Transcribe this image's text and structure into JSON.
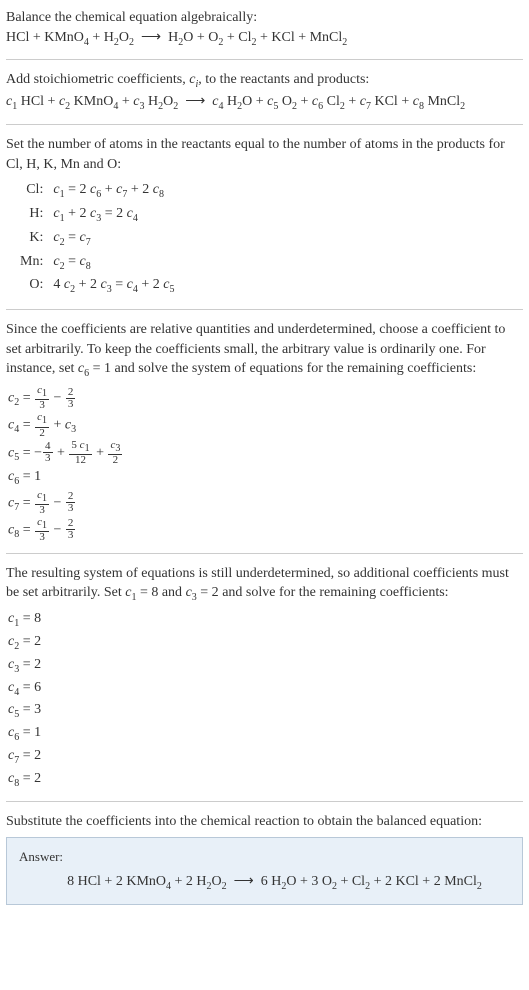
{
  "s1": {
    "line1": "Balance the chemical equation algebraically:",
    "eq": "HCl + KMnO₄ + H₂O₂ ⟶ H₂O + O₂ + Cl₂ + KCl + MnCl₂"
  },
  "s2": {
    "line1_a": "Add stoichiometric coefficients, ",
    "line1_ci": "cᵢ",
    "line1_b": ", to the reactants and products:",
    "eq": "c₁ HCl + c₂ KMnO₄ + c₃ H₂O₂ ⟶ c₄ H₂O + c₅ O₂ + c₆ Cl₂ + c₇ KCl + c₈ MnCl₂"
  },
  "s3": {
    "line1": "Set the number of atoms in the reactants equal to the number of atoms in the products for Cl, H, K, Mn and O:",
    "rows": [
      {
        "el": "Cl:",
        "eq": "c₁ = 2 c₆ + c₇ + 2 c₈"
      },
      {
        "el": "H:",
        "eq": "c₁ + 2 c₃ = 2 c₄"
      },
      {
        "el": "K:",
        "eq": "c₂ = c₇"
      },
      {
        "el": "Mn:",
        "eq": "c₂ = c₈"
      },
      {
        "el": "O:",
        "eq": "4 c₂ + 2 c₃ = c₄ + 2 c₅"
      }
    ]
  },
  "s4": {
    "para": "Since the coefficients are relative quantities and underdetermined, choose a coefficient to set arbitrarily. To keep the coefficients small, the arbitrary value is ordinarily one. For instance, set c₆ = 1 and solve the system of equations for the remaining coefficients:"
  },
  "s5": {
    "para_a": "The resulting system of equations is still underdetermined, so additional coefficients must be set arbitrarily. Set ",
    "para_mid1": "c₁ = 8",
    "para_mid2": " and ",
    "para_mid3": "c₃ = 2",
    "para_b": " and solve for the remaining coefficients:",
    "rows": [
      "c₁ = 8",
      "c₂ = 2",
      "c₃ = 2",
      "c₄ = 6",
      "c₅ = 3",
      "c₆ = 1",
      "c₇ = 2",
      "c₈ = 2"
    ]
  },
  "s6": {
    "para": "Substitute the coefficients into the chemical reaction to obtain the balanced equation:"
  },
  "answer": {
    "label": "Answer:",
    "eq": "8 HCl + 2 KMnO₄ + 2 H₂O₂ ⟶ 6 H₂O + 3 O₂ + Cl₂ + 2 KCl + 2 MnCl₂"
  }
}
